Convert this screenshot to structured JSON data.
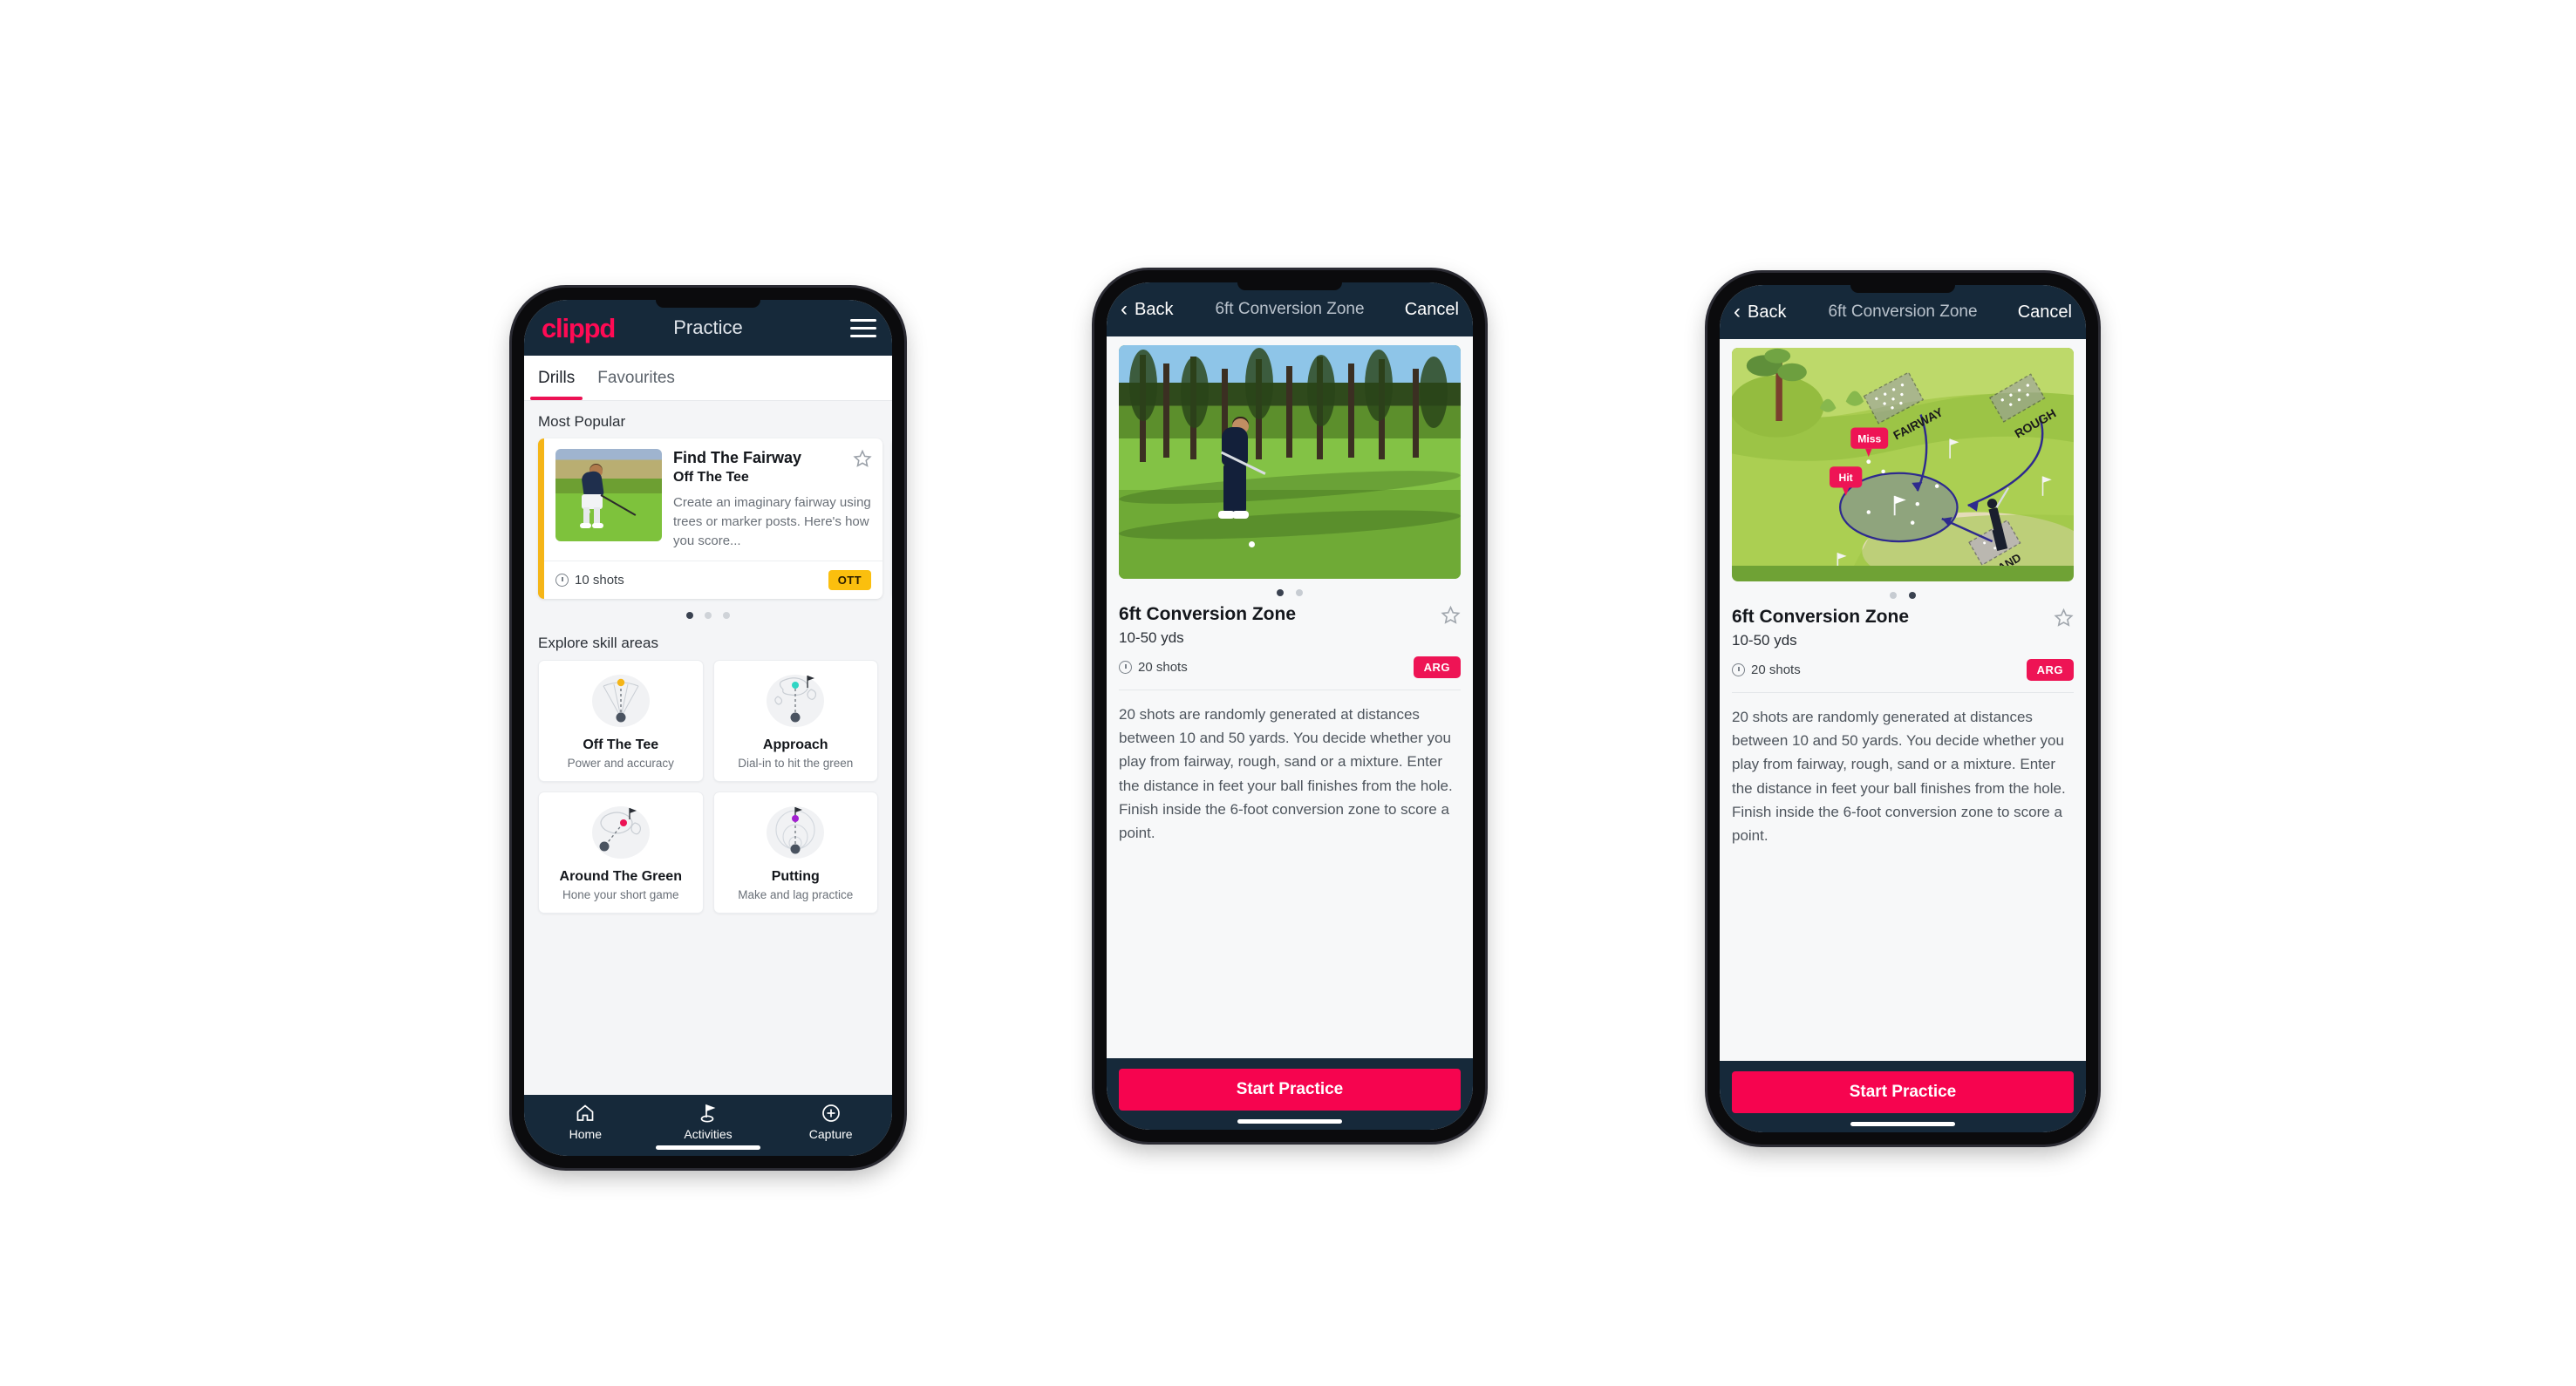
{
  "phone1": {
    "navbar": {
      "logo": "clippd",
      "title": "Practice",
      "menu_icon": "hamburger-menu-icon"
    },
    "tabs": [
      {
        "label": "Drills",
        "active": true
      },
      {
        "label": "Favourites",
        "active": false
      }
    ],
    "most_popular": {
      "section_title": "Most Popular",
      "card": {
        "title": "Find The Fairway",
        "subtitle": "Off The Tee",
        "description": "Create an imaginary fairway using trees or marker posts. Here's how you score...",
        "shots": "10 shots",
        "badge": "OTT",
        "badge_color": "#fbbf0e",
        "accent_color": "#f5b517",
        "star_icon": "star-outline-icon",
        "clock_icon": "clock-icon"
      },
      "next_card_accent": "#2fd6c4",
      "pagination": {
        "count": 3,
        "active_index": 0
      }
    },
    "skills": {
      "section_title": "Explore skill areas",
      "items": [
        {
          "name": "Off The Tee",
          "desc": "Power and accuracy",
          "icon": "tee-fan-icon",
          "dot_color": "#f5b517"
        },
        {
          "name": "Approach",
          "desc": "Dial-in to hit the green",
          "icon": "approach-green-icon",
          "dot_color": "#2fd6c4"
        },
        {
          "name": "Around The Green",
          "desc": "Hone your short game",
          "icon": "around-green-icon",
          "dot_color": "#ec1254"
        },
        {
          "name": "Putting",
          "desc": "Make and lag practice",
          "icon": "putting-rings-icon",
          "dot_color": "#a21fd0"
        }
      ]
    },
    "tabbar": [
      {
        "label": "Home",
        "icon": "home-icon",
        "active": false
      },
      {
        "label": "Activities",
        "icon": "golf-flag-icon",
        "active": true
      },
      {
        "label": "Capture",
        "icon": "plus-circle-icon",
        "active": false
      }
    ]
  },
  "detail": {
    "navbar": {
      "back": "Back",
      "back_icon": "chevron-left-icon",
      "title": "6ft Conversion Zone",
      "cancel": "Cancel"
    },
    "title": "6ft Conversion Zone",
    "subtitle": "10-50 yds",
    "shots": "20 shots",
    "badge": "ARG",
    "badge_color": "#ee1455",
    "star_icon": "star-outline-icon",
    "clock_icon": "clock-icon",
    "description": "20 shots are randomly generated at distances between 10 and 50 yards. You decide whether you play from fairway, rough, sand or a mixture. Enter the distance in feet your ball finishes from the hole. Finish inside the 6-foot conversion zone to score a point.",
    "cta": "Start Practice",
    "cta_color": "#f6044f",
    "pagination": {
      "count": 2
    },
    "phone2_active_index": 0,
    "phone3_active_index": 1,
    "map_labels": {
      "fairway": "FAIRWAY",
      "rough": "ROUGH",
      "sand": "SAND",
      "miss": "Miss",
      "hit": "Hit",
      "miss_color": "#ee1455",
      "hit_color": "#ee1455"
    }
  }
}
